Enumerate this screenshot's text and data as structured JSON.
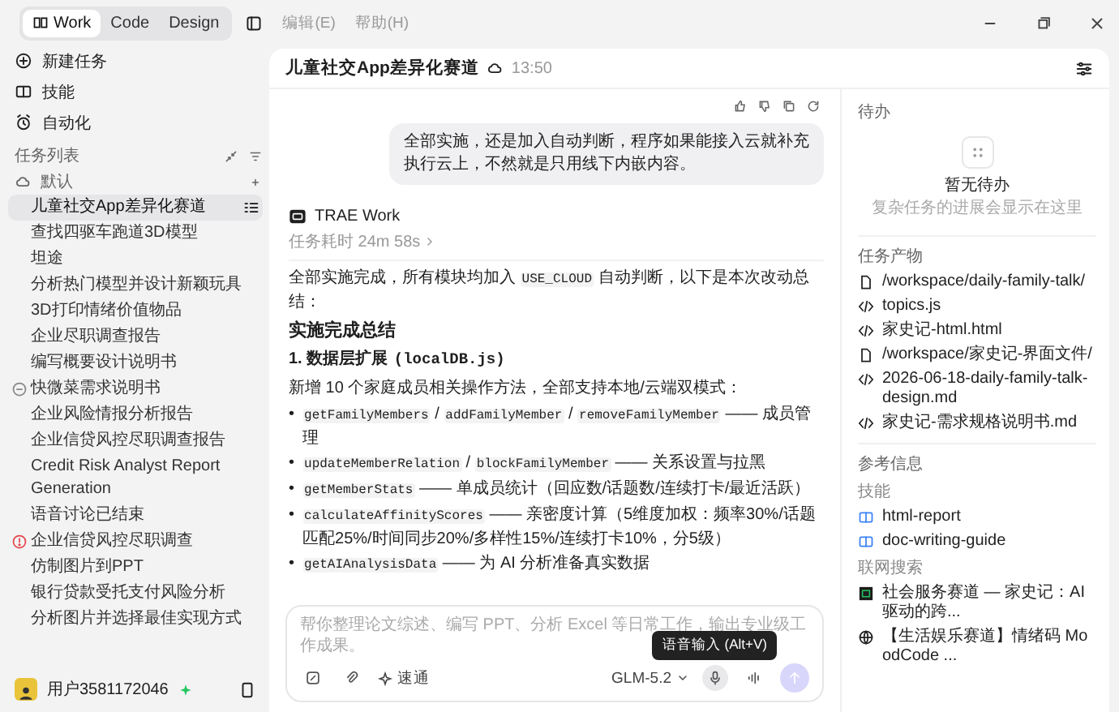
{
  "topbar": {
    "modes": [
      {
        "label": "Work",
        "selected": true
      },
      {
        "label": "Code",
        "selected": false
      },
      {
        "label": "Design",
        "selected": false
      }
    ],
    "menus": [
      "编辑(E)",
      "帮助(H)"
    ]
  },
  "sidebar": {
    "nav": [
      {
        "label": "新建任务"
      },
      {
        "label": "技能"
      },
      {
        "label": "自动化"
      }
    ],
    "section_title": "任务列表",
    "group": "默认",
    "tasks": [
      {
        "label": "儿童社交App差异化赛道",
        "selected": true,
        "kind": "plain"
      },
      {
        "label": "查找四驱车跑道3D模型",
        "selected": false,
        "kind": "plain"
      },
      {
        "label": "坦途",
        "selected": false,
        "kind": "plain"
      },
      {
        "label": "分析热门模型并设计新颖玩具",
        "selected": false,
        "kind": "plain"
      },
      {
        "label": "3D打印情绪价值物品",
        "selected": false,
        "kind": "plain"
      },
      {
        "label": "企业尽职调查报告",
        "selected": false,
        "kind": "plain"
      },
      {
        "label": "编写概要设计说明书",
        "selected": false,
        "kind": "plain"
      },
      {
        "label": "快微菜需求说明书",
        "selected": false,
        "kind": "pending"
      },
      {
        "label": "企业风险情报分析报告",
        "selected": false,
        "kind": "plain"
      },
      {
        "label": "企业信贷风控尽职调查报告",
        "selected": false,
        "kind": "plain"
      },
      {
        "label": "Credit Risk Analyst Report Generation",
        "selected": false,
        "kind": "plain"
      },
      {
        "label": "语音讨论已结束",
        "selected": false,
        "kind": "plain"
      },
      {
        "label": "企业信贷风控尽职调查",
        "selected": false,
        "kind": "alert"
      },
      {
        "label": "仿制图片到PPT",
        "selected": false,
        "kind": "plain"
      },
      {
        "label": "银行贷款受托支付风险分析",
        "selected": false,
        "kind": "plain"
      },
      {
        "label": "分析图片并选择最佳实现方式",
        "selected": false,
        "kind": "plain"
      }
    ],
    "user": {
      "name": "用户3581172046"
    }
  },
  "header": {
    "title": "儿童社交App差异化赛道",
    "time": "13:50"
  },
  "chat": {
    "user_message": "全部实施，还是加入自动判断，程序如果能接入云就补充执行云上，不然就是只用线下内嵌内容。",
    "agent_name": "TRAE Work",
    "duration": "任务耗时 24m 58s",
    "intro": [
      {
        "kind": "text",
        "text": "全部实施完成，所有模块均加入 "
      },
      {
        "kind": "code",
        "text": "USE_CLOUD"
      },
      {
        "kind": "text",
        "text": " 自动判断，以下是本次改动总结："
      }
    ],
    "heading": "实施完成总结",
    "subheading": [
      {
        "kind": "text",
        "text": "1. 数据层扩展 "
      },
      {
        "kind": "code",
        "text": "(localDB.js)"
      }
    ],
    "paragraph": "新增 10 个家庭成员相关操作方法，全部支持本地/云端双模式：",
    "bullets": [
      {
        "marker": "•",
        "parts": [
          {
            "kind": "code",
            "text": "getFamilyMembers"
          },
          {
            "kind": "text",
            "text": " / "
          },
          {
            "kind": "code",
            "text": "addFamilyMember"
          },
          {
            "kind": "text",
            "text": " / "
          },
          {
            "kind": "code",
            "text": "removeFamilyMember"
          },
          {
            "kind": "text",
            "text": " —— 成员管理"
          }
        ]
      },
      {
        "marker": "•",
        "parts": [
          {
            "kind": "code",
            "text": "updateMemberRelation"
          },
          {
            "kind": "text",
            "text": " / "
          },
          {
            "kind": "code",
            "text": "blockFamilyMember"
          },
          {
            "kind": "text",
            "text": " —— 关系设置与拉黑"
          }
        ]
      },
      {
        "marker": "•",
        "parts": [
          {
            "kind": "code",
            "text": "getMemberStats"
          },
          {
            "kind": "text",
            "text": " —— 单成员统计（回应数/话题数/连续打卡/最近活跃）"
          }
        ]
      },
      {
        "marker": "•",
        "parts": [
          {
            "kind": "code",
            "text": "calculateAffinityScores"
          },
          {
            "kind": "text",
            "text": " —— 亲密度计算（5维度加权：频率30%/话题匹配25%/时间同步20%/多样性15%/连续打卡10%，分5级）"
          }
        ]
      },
      {
        "marker": "•",
        "parts": [
          {
            "kind": "code",
            "text": "getAIAnalysisData"
          },
          {
            "kind": "text",
            "text": " —— 为 AI 分析准备真实数据"
          }
        ]
      }
    ]
  },
  "composer": {
    "placeholder": "帮你整理论文综述、编写 PPT、分析 Excel 等日常工作，输出专业级工作成果。",
    "mode_button": "速通",
    "model": "GLM-5.2",
    "tooltip": "语音输入 (Alt+V)"
  },
  "panel": {
    "todo_title": "待办",
    "empty_title": "暂无待办",
    "empty_hint": "复杂任务的进展会显示在这里",
    "outputs_title": "任务产物",
    "outputs": [
      {
        "name": "/workspace/daily-family-talk/",
        "kind": "folder"
      },
      {
        "name": "topics.js",
        "kind": "code"
      },
      {
        "name": "家史记-html.html",
        "kind": "code"
      },
      {
        "name": "/workspace/家史记-界面文件/",
        "kind": "folder"
      },
      {
        "name": "2026-06-18-daily-family-talk-design.md",
        "kind": "code"
      },
      {
        "name": "家史记-需求规格说明书.md",
        "kind": "code"
      }
    ],
    "refs_title": "参考信息",
    "skills_title": "技能",
    "skills": [
      "html-report",
      "doc-writing-guide"
    ],
    "web_title": "联网搜索",
    "web": [
      {
        "title": "社会服务赛道 — 家史记：AI驱动的跨...",
        "kind": "site"
      },
      {
        "title": "【生活娱乐赛道】情绪码 MoodCode ...",
        "kind": "globe"
      }
    ]
  }
}
